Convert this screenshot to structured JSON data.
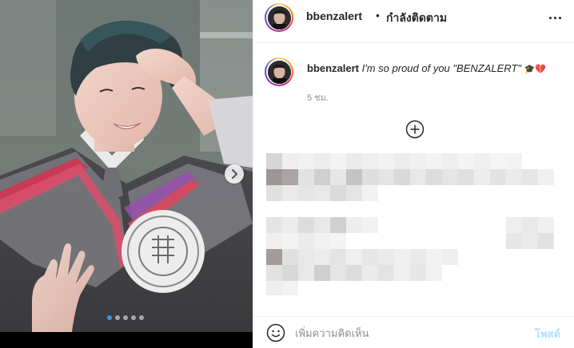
{
  "header": {
    "username": "bbenzalert",
    "separator": "•",
    "follow_status": "กำลังติดตาม"
  },
  "caption": {
    "username": "bbenzalert",
    "text": "I'm so proud of you \"BENZALERT\"",
    "emoji": "🎓💔",
    "time": "5 ชม."
  },
  "media": {
    "total_slides": 5,
    "active_slide": 1
  },
  "comment_box": {
    "placeholder": "เพิ่มความคิดเห็น",
    "post_label": "โพสต์"
  },
  "colors": {
    "link_disabled": "#b2dffc",
    "active_dot": "#3897f0",
    "divider": "#efefef",
    "secondary_text": "#8e8e8e"
  },
  "icons": {
    "more": "more-options-icon",
    "load_more": "plus-circle-icon",
    "emoji": "emoji-icon",
    "next": "chevron-right-icon"
  }
}
